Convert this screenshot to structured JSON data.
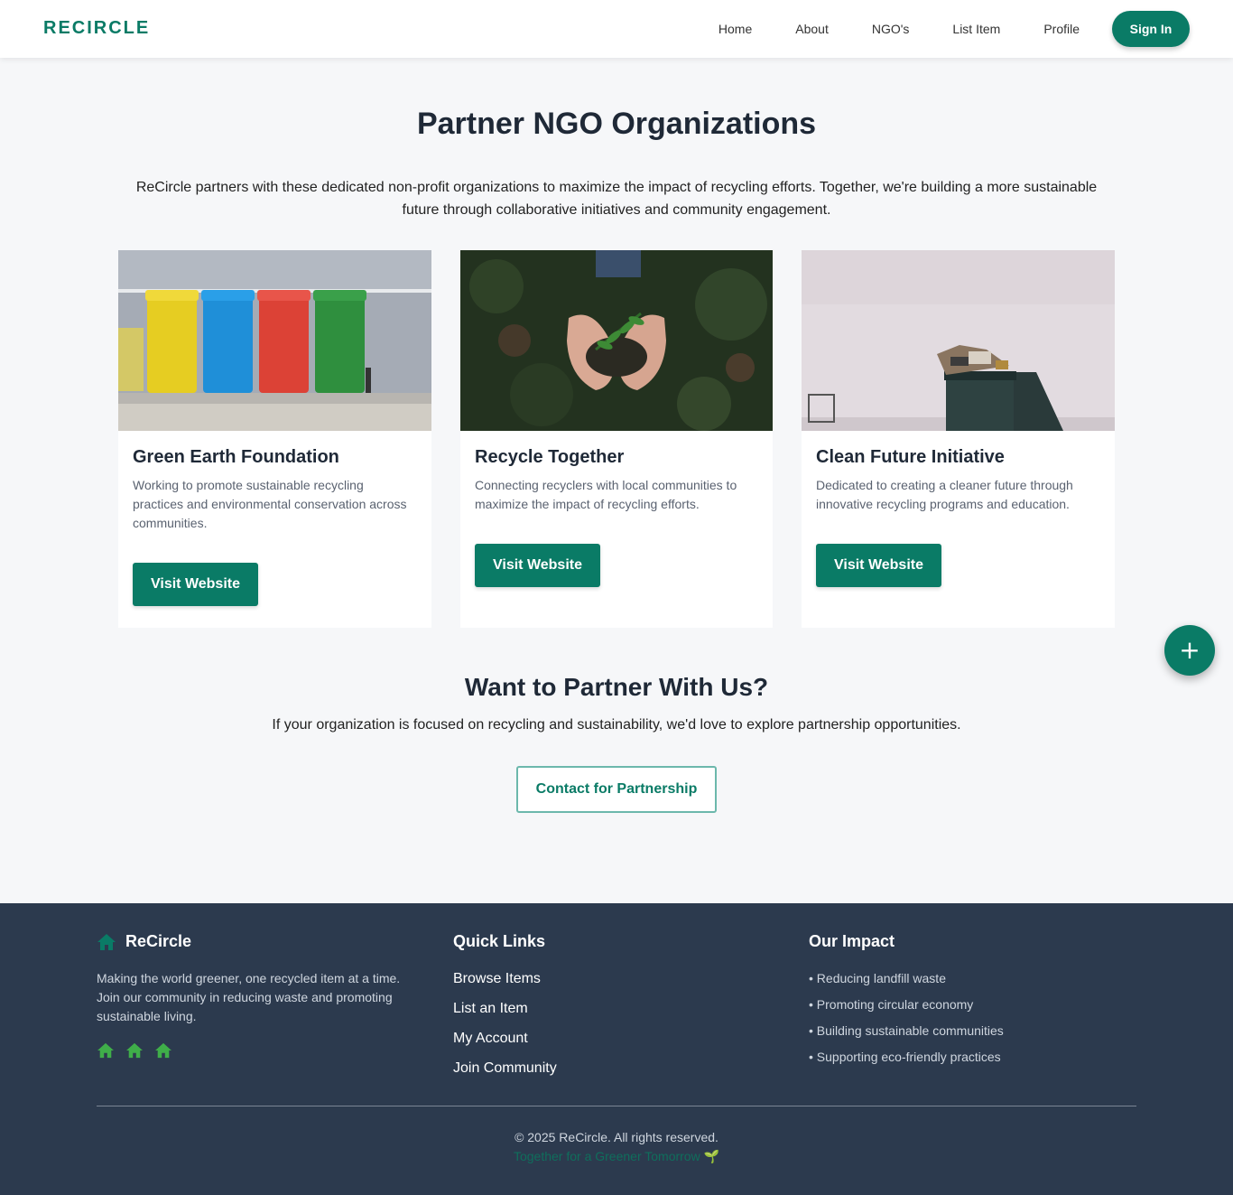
{
  "header": {
    "logo": "RECIRCLE",
    "nav": [
      "Home",
      "About",
      "NGO's",
      "List Item",
      "Profile"
    ],
    "sign_in": "Sign In"
  },
  "hero": {
    "title": "Partner NGO Organizations",
    "intro": "ReCircle partners with these dedicated non-profit organizations to maximize the impact of recycling efforts. Together, we're building a more sustainable future through collaborative initiatives and community engagement."
  },
  "cards": [
    {
      "title": "Green Earth Foundation",
      "description": "Working to promote sustainable recycling practices and environmental conservation across communities.",
      "button": "Visit Website"
    },
    {
      "title": "Recycle Together",
      "description": "Connecting recyclers with local communities to maximize the impact of recycling efforts.",
      "button": "Visit Website"
    },
    {
      "title": "Clean Future Initiative",
      "description": "Dedicated to creating a cleaner future through innovative recycling programs and education.",
      "button": "Visit Website"
    }
  ],
  "partner": {
    "title": "Want to Partner With Us?",
    "text": "If your organization is focused on recycling and sustainability, we'd love to explore partnership opportunities.",
    "button": "Contact for Partnership"
  },
  "fab": {
    "icon": "plus-icon",
    "label": "+"
  },
  "footer": {
    "brand": "ReCircle",
    "about": "Making the world greener, one recycled item at a time. Join our community in reducing waste and promoting sustainable living.",
    "quick_links_title": "Quick Links",
    "quick_links": [
      "Browse Items",
      "List an Item",
      "My Account",
      "Join Community"
    ],
    "impact_title": "Our Impact",
    "impact": [
      "• Reducing landfill waste",
      "• Promoting circular economy",
      "• Building sustainable communities",
      "• Supporting eco-friendly practices"
    ],
    "copyright": "© 2025 ReCircle. All rights reserved.",
    "tagline": "Together for a Greener Tomorrow 🌱"
  },
  "colors": {
    "primary": "#0a7b66",
    "footer_bg": "#2c3a4e",
    "page_bg": "#f6f7f9",
    "social_icon": "#3fae49"
  }
}
